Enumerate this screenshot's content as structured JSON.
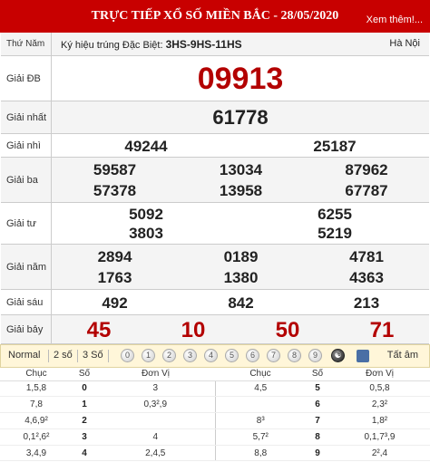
{
  "header": {
    "title": "TRỰC TIẾP XỔ SỐ MIỀN BẮC - 28/05/2020",
    "more_link": "Xem thêm!..."
  },
  "info_row": {
    "label": "Thứ Năm",
    "code_prefix": "Ký hiệu trúng Đặc Biệt:",
    "code": "3HS-9HS-11HS",
    "city": "Hà Nội"
  },
  "prizes": {
    "db": {
      "label": "Giải ĐB",
      "numbers": [
        "09913"
      ]
    },
    "nhat": {
      "label": "Giải nhất",
      "numbers": [
        "61778"
      ]
    },
    "nhi": {
      "label": "Giải nhì",
      "numbers": [
        "49244",
        "25187"
      ]
    },
    "ba": {
      "label": "Giải ba",
      "numbers": [
        "59587",
        "13034",
        "87962",
        "57378",
        "13958",
        "67787"
      ]
    },
    "tu": {
      "label": "Giải tư",
      "numbers": [
        "5092",
        "6255",
        "3803",
        "5219"
      ]
    },
    "nam": {
      "label": "Giải năm",
      "numbers": [
        "2894",
        "0189",
        "4781",
        "1763",
        "1380",
        "4363"
      ]
    },
    "sau": {
      "label": "Giải sáu",
      "numbers": [
        "492",
        "842",
        "213"
      ]
    },
    "bay": {
      "label": "Giải bảy",
      "numbers": [
        "45",
        "10",
        "50",
        "71"
      ]
    }
  },
  "toolbar": {
    "tabs": [
      "Normal",
      "2 số",
      "3 Số"
    ],
    "digits": [
      "0",
      "1",
      "2",
      "3",
      "4",
      "5",
      "6",
      "7",
      "8",
      "9"
    ],
    "all_label": "Tất âm"
  },
  "loto": {
    "headers": [
      "Chục",
      "Số",
      "Đơn Vị",
      "Chục",
      "Số",
      "Đơn Vị"
    ],
    "rows": [
      [
        "1,5,8",
        "0",
        "3",
        "4,5",
        "5",
        "0,5,8"
      ],
      [
        "7,8",
        "1",
        "0,3²,9",
        "",
        "6",
        "2,3²"
      ],
      [
        "4,6,9²",
        "2",
        "",
        "8³",
        "7",
        "1,8²"
      ],
      [
        "0,1²,6²",
        "3",
        "4",
        "5,7²",
        "8",
        "0,1,7³,9"
      ],
      [
        "3,4,9",
        "4",
        "2,4,5",
        "8,8",
        "9",
        "2²,4"
      ]
    ]
  },
  "colors": {
    "header_bg": "#c80000",
    "special_prize": "#b30000"
  }
}
